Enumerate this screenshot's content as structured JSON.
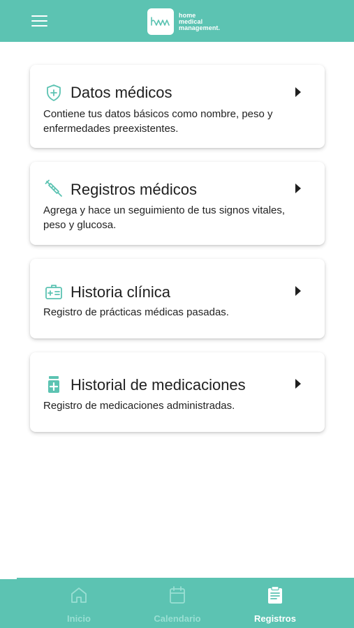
{
  "app": {
    "logo_lines": [
      "home",
      "medical",
      "management."
    ],
    "brand_color": "#5cc3b2"
  },
  "cards": [
    {
      "title": "Datos médicos",
      "description": "Contiene tus datos básicos como nombre, peso y enfermedades preexistentes.",
      "icon": "shield-plus-icon"
    },
    {
      "title": "Registros médicos",
      "description": "Agrega y hace un seguimiento de tus signos vitales, peso y glucosa.",
      "icon": "syringe-icon"
    },
    {
      "title": "Historia clínica",
      "description": "Registro de prácticas médicas pasadas.",
      "icon": "medical-id-card-icon"
    },
    {
      "title": "Historial de medicaciones",
      "description": "Registro de medicaciones administradas.",
      "icon": "medicine-bottle-icon"
    }
  ],
  "bottom_nav": {
    "items": [
      {
        "label": "Inicio",
        "icon": "home-icon",
        "active": false
      },
      {
        "label": "Calendario",
        "icon": "calendar-icon",
        "active": false
      },
      {
        "label": "Registros",
        "icon": "clipboard-icon",
        "active": true
      }
    ],
    "active_color": "#ffffff",
    "inactive_color": "#9adfd3"
  }
}
